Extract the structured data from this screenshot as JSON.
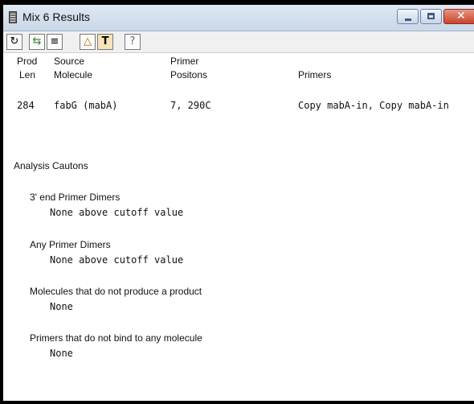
{
  "window": {
    "title": "Mix 6 Results"
  },
  "toolbar": {
    "buttons": [
      {
        "icon": "refresh-icon",
        "glyph": "↻"
      },
      {
        "icon": "align-icon",
        "glyph": "⇆"
      },
      {
        "icon": "document-icon",
        "glyph": "≡"
      },
      {
        "icon": "warning-icon",
        "glyph": "△"
      },
      {
        "icon": "primer-icon",
        "glyph": "T"
      },
      {
        "icon": "help-icon",
        "glyph": "?"
      }
    ]
  },
  "table": {
    "headers": {
      "prod_line1": "Prod",
      "prod_line2": "Len",
      "source_line1": "Source",
      "source_line2": "Molecule",
      "primer_line1": "Primer",
      "primer_line2": "Positons",
      "primers": "Primers"
    },
    "row": {
      "prod_len": "284",
      "source": "fabG (mabA)",
      "positions": "7, 290C",
      "primers": "Copy mabA-in, Copy mabA-in"
    }
  },
  "analysis": {
    "heading": "Analysis Cautons",
    "sections": [
      {
        "title": "3' end Primer Dimers",
        "value": "None above cutoff value"
      },
      {
        "title": "Any Primer Dimers",
        "value": "None above cutoff value"
      },
      {
        "title": "Molecules that do not produce a product",
        "value": "None"
      },
      {
        "title": "Primers that do not bind to any molecule",
        "value": "None"
      }
    ]
  }
}
